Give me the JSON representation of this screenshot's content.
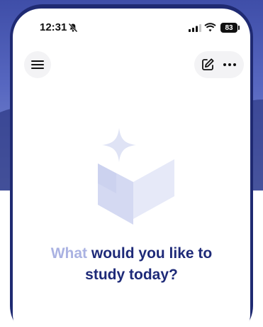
{
  "status_bar": {
    "time": "12:31",
    "silent_icon": "bell-slash-icon",
    "signal_icon": "cellular-signal-icon",
    "wifi_icon": "wifi-icon",
    "battery_level": "83"
  },
  "toolbar": {
    "menu_icon": "hamburger-menu-icon",
    "new_chat_icon": "compose-icon",
    "more_icon": "ellipsis-icon"
  },
  "main": {
    "logo_icon": "star-chevron-logo",
    "prompt_faded": "What",
    "prompt_rest_line1": " would you like to",
    "prompt_line2": "study today?"
  },
  "colors": {
    "background_blue": "#3f4ea8",
    "prompt_text": "#1e2a78",
    "prompt_faded_text": "#aab2e2",
    "logo_light": "#dfe3f5",
    "logo_mid": "#c9cfee"
  }
}
